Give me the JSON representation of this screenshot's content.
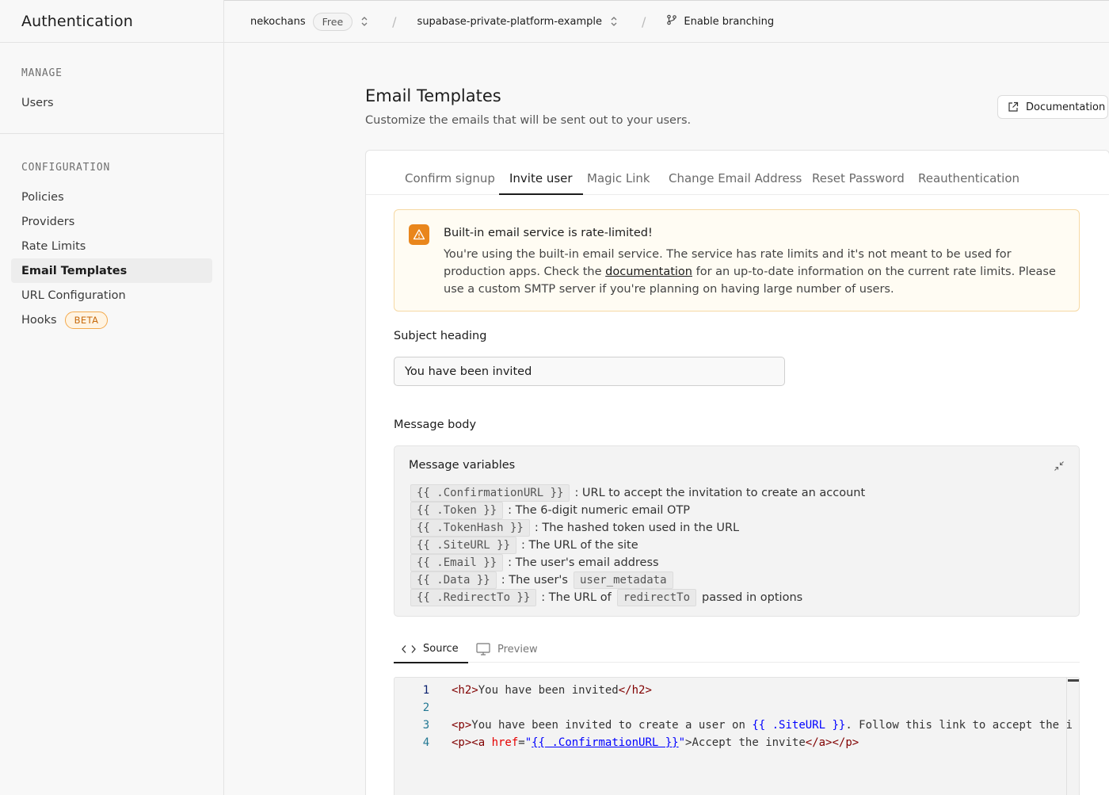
{
  "sidebar": {
    "title": "Authentication",
    "manage_heading": "MANAGE",
    "manage_items": [
      {
        "label": "Users"
      }
    ],
    "config_heading": "CONFIGURATION",
    "config_items": [
      {
        "label": "Policies"
      },
      {
        "label": "Providers"
      },
      {
        "label": "Rate Limits"
      },
      {
        "label": "Email Templates",
        "active": true
      },
      {
        "label": "URL Configuration"
      },
      {
        "label": "Hooks",
        "badge": "BETA"
      }
    ]
  },
  "topbar": {
    "org": "nekochans",
    "plan": "Free",
    "separator": "/",
    "project": "supabase-private-platform-example",
    "branching": "Enable branching"
  },
  "page": {
    "title": "Email Templates",
    "subtitle": "Customize the emails that will be sent out to your users.",
    "doc_button": "Documentation"
  },
  "tabs": [
    {
      "label": "Confirm signup"
    },
    {
      "label": "Invite user",
      "active": true
    },
    {
      "label": "Magic Link"
    },
    {
      "label": "Change Email Address"
    },
    {
      "label": "Reset Password"
    },
    {
      "label": "Reauthentication"
    }
  ],
  "alert": {
    "title": "Built-in email service is rate-limited!",
    "body_before": "You're using the built-in email service. The service has rate limits and it's not meant to be used for production apps. Check the ",
    "link": "documentation",
    "body_after": " for an up-to-date information on the current rate limits. Please use a custom SMTP server if you're planning on having large number of users.",
    "color": "#e9861c"
  },
  "subject": {
    "label": "Subject heading",
    "value": "You have been invited"
  },
  "message": {
    "label": "Message body",
    "vars_title": "Message variables",
    "variables": [
      {
        "code": "{{ .ConfirmationURL }}",
        "desc": ": URL to accept the invitation to create an account"
      },
      {
        "code": "{{ .Token }}",
        "desc": ": The 6-digit numeric email OTP"
      },
      {
        "code": "{{ .TokenHash }}",
        "desc": ": The hashed token used in the URL"
      },
      {
        "code": "{{ .SiteURL }}",
        "desc": ": The URL of the site"
      },
      {
        "code": "{{ .Email }}",
        "desc": ": The user's email address"
      },
      {
        "code": "{{ .Data }}",
        "desc": ": The user's",
        "code2": "user_metadata",
        "desc2": ""
      },
      {
        "code": "{{ .RedirectTo }}",
        "desc": ": The URL of",
        "code2": "redirectTo",
        "desc2": "passed in options"
      }
    ]
  },
  "editor": {
    "source_tab": "Source",
    "preview_tab": "Preview",
    "line_numbers": [
      "1",
      "2",
      "3",
      "4"
    ],
    "line1": {
      "open": "<h2>",
      "text": "You have been invited",
      "close": "</h2>"
    },
    "line3": {
      "open": "<p>",
      "text": "You have been invited to create a user on ",
      "var": "{{ .SiteURL }}",
      "rest": ". Follow this link to accept the i"
    },
    "line4": {
      "open": "<p><a ",
      "attr": "href",
      "eq": "=",
      "q1": "\"",
      "var": "{{ .ConfirmationURL }}",
      "q2": "\"",
      "mid": ">Accept the invite",
      "close": "</a></p>"
    }
  }
}
